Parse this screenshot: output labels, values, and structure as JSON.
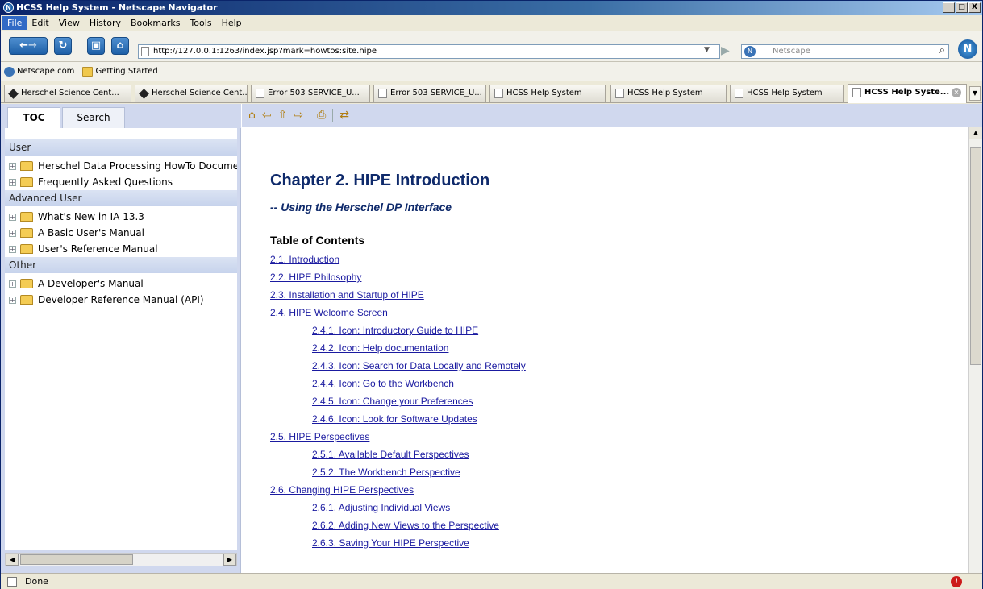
{
  "window": {
    "title": "HCSS Help System - Netscape Navigator",
    "buttons": [
      "_",
      "□",
      "X"
    ]
  },
  "menu": [
    "File",
    "Edit",
    "View",
    "History",
    "Bookmarks",
    "Tools",
    "Help"
  ],
  "navbar": {
    "url": "http://127.0.0.1:1263/index.jsp?mark=howtos:site.hipe",
    "search_placeholder": "Netscape",
    "logo_letter": "N"
  },
  "bookmarks": [
    {
      "label": "Netscape.com",
      "icon": "globe-icon"
    },
    {
      "label": "Getting Started",
      "icon": "folder-icon"
    }
  ],
  "tabs": [
    {
      "label": "Herschel Science Cent...",
      "icon": "diamond"
    },
    {
      "label": "Herschel Science Cent...",
      "icon": "diamond"
    },
    {
      "label": "Error 503 SERVICE_U...",
      "icon": "doc"
    },
    {
      "label": "Error 503 SERVICE_U...",
      "icon": "doc"
    },
    {
      "label": "HCSS Help System",
      "icon": "doc"
    },
    {
      "label": "HCSS Help System",
      "icon": "doc"
    },
    {
      "label": "HCSS Help System",
      "icon": "doc"
    },
    {
      "label": "HCSS Help Syste...",
      "icon": "doc",
      "active": true
    }
  ],
  "sidebar": {
    "tabs": [
      "TOC",
      "Search"
    ],
    "groups": [
      {
        "header": "User",
        "items": [
          "Herschel Data Processing HowTo Documer",
          "Frequently Asked Questions"
        ]
      },
      {
        "header": "Advanced User",
        "items": [
          "What's New in IA 13.3",
          "A Basic User's Manual",
          "User's Reference Manual"
        ]
      },
      {
        "header": "Other",
        "items": [
          "A Developer's Manual",
          "Developer Reference Manual (API)"
        ]
      }
    ]
  },
  "document": {
    "title": "Chapter 2. HIPE Introduction",
    "subtitle": "-- Using the Herschel DP Interface",
    "toc_heading": "Table of Contents",
    "toc": [
      {
        "text": "2.1. Introduction",
        "level": 1
      },
      {
        "text": "2.2. HIPE Philosophy",
        "level": 1
      },
      {
        "text": "2.3. Installation and Startup of HIPE",
        "level": 1
      },
      {
        "text": "2.4. HIPE Welcome Screen",
        "level": 1
      },
      {
        "text": "2.4.1. Icon: Introductory Guide to HIPE",
        "level": 2
      },
      {
        "text": "2.4.2. Icon: Help documentation",
        "level": 2
      },
      {
        "text": "2.4.3. Icon: Search for Data Locally and Remotely",
        "level": 2
      },
      {
        "text": "2.4.4. Icon: Go to the Workbench",
        "level": 2
      },
      {
        "text": "2.4.5. Icon: Change your Preferences",
        "level": 2
      },
      {
        "text": "2.4.6. Icon: Look for Software Updates",
        "level": 2
      },
      {
        "text": "2.5. HIPE Perspectives",
        "level": 1
      },
      {
        "text": "2.5.1. Available Default Perspectives",
        "level": 2
      },
      {
        "text": "2.5.2. The Workbench Perspective",
        "level": 2
      },
      {
        "text": "2.6. Changing HIPE Perspectives",
        "level": 1
      },
      {
        "text": "2.6.1. Adjusting Individual Views",
        "level": 2
      },
      {
        "text": "2.6.2. Adding New Views to the Perspective",
        "level": 2
      },
      {
        "text": "2.6.3. Saving Your HIPE Perspective",
        "level": 2
      }
    ]
  },
  "status": {
    "text": "Done"
  }
}
